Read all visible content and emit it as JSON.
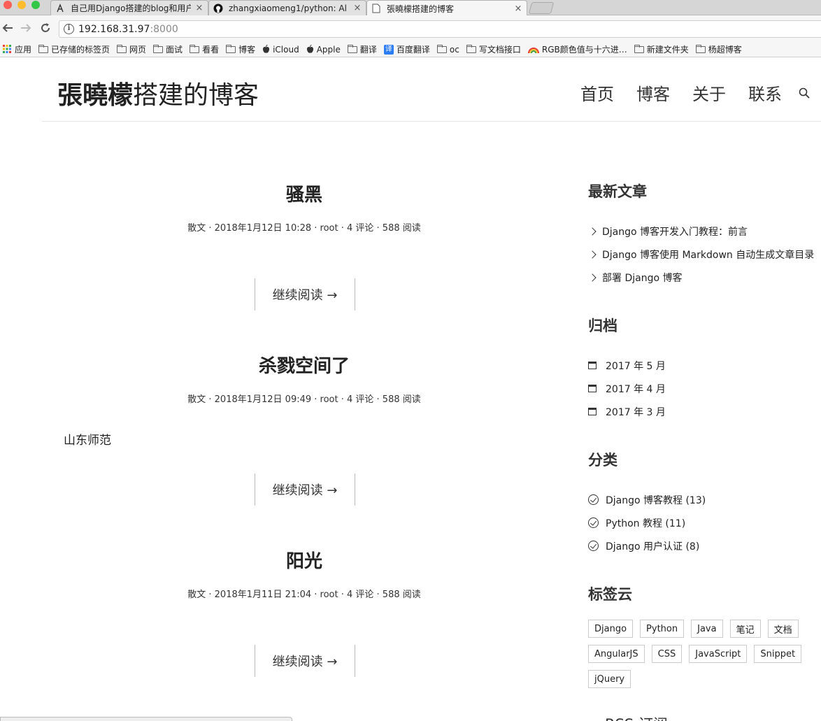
{
  "browser": {
    "tabs": [
      {
        "title": "自己用Django搭建的blog和用户",
        "icon": "weibo-like-icon"
      },
      {
        "title": "zhangxiaomeng1/python: Al",
        "icon": "github-icon"
      },
      {
        "title": "張曉檬搭建的博客",
        "icon": "page-icon"
      }
    ],
    "close_glyph": "×",
    "address_host": "192.168.31.97",
    "address_port": ":8000",
    "bookmarks": [
      {
        "label": "应用",
        "icon": "apps-grid-icon"
      },
      {
        "label": "已存储的标签页",
        "icon": "folder-icon"
      },
      {
        "label": "网页",
        "icon": "folder-icon"
      },
      {
        "label": "面试",
        "icon": "folder-icon"
      },
      {
        "label": "看看",
        "icon": "folder-icon"
      },
      {
        "label": "博客",
        "icon": "folder-icon"
      },
      {
        "label": "iCloud",
        "icon": "apple-icon"
      },
      {
        "label": "Apple",
        "icon": "apple-icon"
      },
      {
        "label": "翻译",
        "icon": "folder-icon"
      },
      {
        "label": "百度翻译",
        "icon": "translate-icon"
      },
      {
        "label": "oc",
        "icon": "folder-icon"
      },
      {
        "label": "写文档接口",
        "icon": "folder-icon"
      },
      {
        "label": "RGB颜色值与十六进…",
        "icon": "rainbow-icon"
      },
      {
        "label": "新建文件夹",
        "icon": "folder-icon"
      },
      {
        "label": "杨超博客",
        "icon": "folder-icon"
      }
    ]
  },
  "site": {
    "logo_bold": "張曉檬",
    "logo_rest": "搭建的博客",
    "nav": [
      "首页",
      "博客",
      "关于",
      "联系"
    ]
  },
  "posts": [
    {
      "title": "骚黑",
      "meta": "散文 · 2018年1月12日 10:28 · root · 4 评论 · 588 阅读",
      "excerpt": "",
      "more": "继续阅读 →"
    },
    {
      "title": "杀戮空间了",
      "meta": "散文 · 2018年1月12日 09:49 · root · 4 评论 · 588 阅读",
      "excerpt": "山东师范",
      "more": "继续阅读 →"
    },
    {
      "title": "阳光",
      "meta": "散文 · 2018年1月11日 21:04 · root · 4 评论 · 588 阅读",
      "excerpt": "",
      "more": "继续阅读 →"
    }
  ],
  "sidebar": {
    "recent": {
      "title": "最新文章",
      "items": [
        "Django 博客开发入门教程：前言",
        "Django 博客使用 Markdown 自动生成文章目录",
        "部署 Django 博客"
      ]
    },
    "archive": {
      "title": "归档",
      "items": [
        "2017 年 5 月",
        "2017 年 4 月",
        "2017 年 3 月"
      ]
    },
    "categories": {
      "title": "分类",
      "items": [
        "Django 博客教程 (13)",
        "Python 教程 (11)",
        "Django 用户认证 (8)"
      ]
    },
    "tags": {
      "title": "标签云",
      "items": [
        "Django",
        "Python",
        "Java",
        "笔记",
        "文档",
        "AngularJS",
        "CSS",
        "JavaScript",
        "Snippet",
        "jQuery"
      ]
    },
    "rss_title": "RSS 订阅"
  },
  "colors": {
    "traffic_red": "#fc5f57",
    "traffic_yellow": "#fdbc2e",
    "traffic_green": "#33c748"
  }
}
